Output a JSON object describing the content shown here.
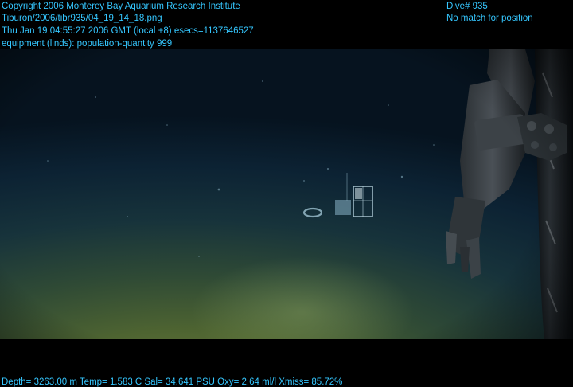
{
  "overlay": {
    "copyright": "Copyright 2006 Monterey Bay Aquarium Research Institute",
    "filename": "Tiburon/2006/tibr935/04_19_14_18.png",
    "timestamp": "Thu Jan 19 04:55:27 2006 GMT (local +8)  esecs=1137646527",
    "equipment": "equipment (linds): population-quantity 999",
    "dive": "Dive# 935",
    "position": "No match for position",
    "sensors": "Depth= 3263.00 m  Temp= 1.583 C  Sal= 34.641 PSU  Oxy= 2.64 ml/l  Xmiss= 85.72%"
  },
  "colors": {
    "overlay_text": "#35c7ff",
    "background": "#000000"
  }
}
